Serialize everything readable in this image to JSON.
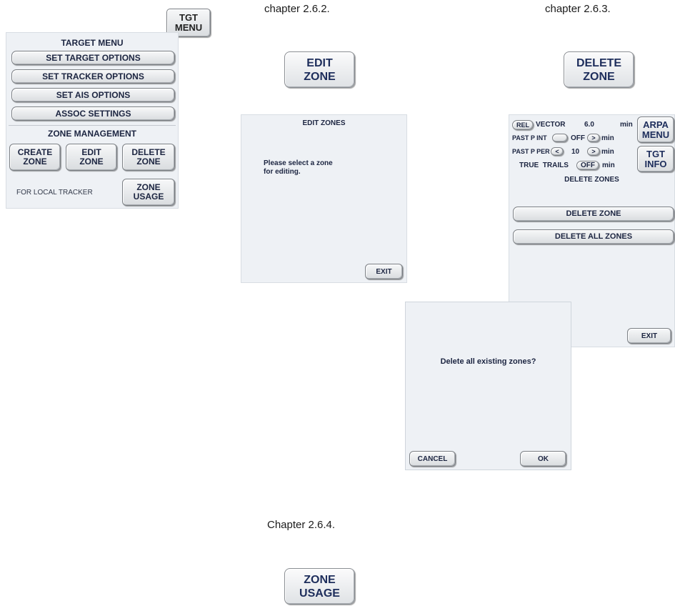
{
  "chapters": {
    "c262": "chapter 2.6.2.",
    "c263": "chapter 2.6.3.",
    "c264": "Chapter 2.6.4."
  },
  "tgt_menu_button": {
    "line1": "TGT",
    "line2": "MENU"
  },
  "target_menu": {
    "title": "TARGET MENU",
    "items": [
      "SET TARGET OPTIONS",
      "SET TRACKER OPTIONS",
      "SET AIS OPTIONS",
      "ASSOC SETTINGS"
    ],
    "zone_section_title": "ZONE MANAGEMENT",
    "zone_buttons": [
      {
        "line1": "CREATE",
        "line2": "ZONE"
      },
      {
        "line1": "EDIT",
        "line2": "ZONE"
      },
      {
        "line1": "DELETE",
        "line2": "ZONE"
      }
    ],
    "local_tracker_label": "FOR LOCAL TRACKER",
    "zone_usage": {
      "line1": "ZONE",
      "line2": "USAGE"
    }
  },
  "edit_zone_button": {
    "line1": "EDIT",
    "line2": "ZONE"
  },
  "delete_zone_button": {
    "line1": "DELETE",
    "line2": "ZONE"
  },
  "edit_zones_panel": {
    "title": "EDIT ZONES",
    "message_line1": "Please select a zone",
    "message_line2": "for editing.",
    "exit": "EXIT"
  },
  "delete_zones_panel": {
    "vector": {
      "mode": "REL",
      "label": "VECTOR",
      "value": "6.0",
      "unit": "min"
    },
    "past_p_int": {
      "label": "PAST P INT",
      "value": "OFF",
      "arrow": ">",
      "unit": "min"
    },
    "past_p_per": {
      "label": "PAST P PER",
      "left_arrow": "<",
      "value": "10",
      "arrow": ">",
      "unit": "min"
    },
    "true_trails": {
      "label": "TRUE  TRAILS",
      "value": "OFF",
      "unit": "min"
    },
    "arpa_menu": {
      "line1": "ARPA",
      "line2": "MENU"
    },
    "tgt_info": {
      "line1": "TGT",
      "line2": "INFO"
    },
    "title": "DELETE ZONES",
    "delete_zone": "DELETE ZONE",
    "delete_all_zones": "DELETE ALL ZONES",
    "exit": "EXIT"
  },
  "confirm_dialog": {
    "message": "Delete all existing zones?",
    "cancel": "CANCEL",
    "ok": "OK"
  },
  "zone_usage_button": {
    "line1": "ZONE",
    "line2": "USAGE"
  }
}
